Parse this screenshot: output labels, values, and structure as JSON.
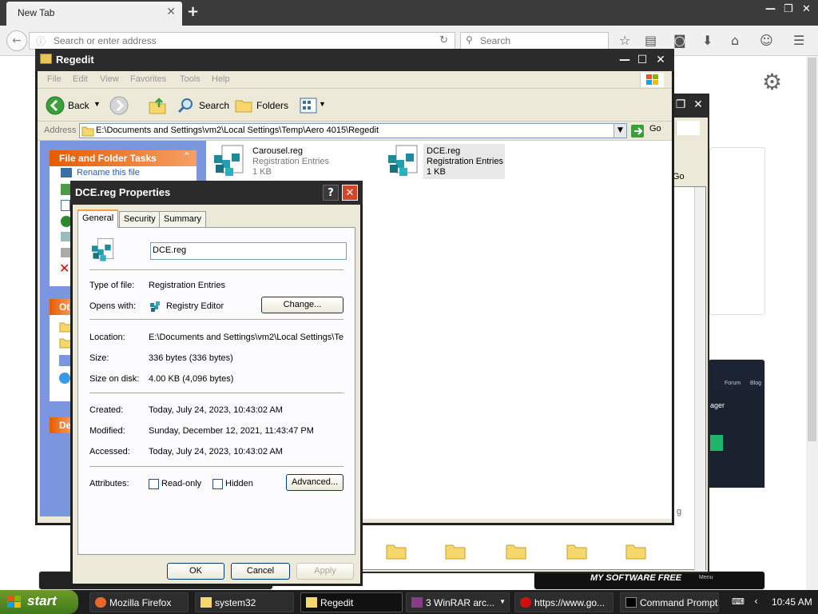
{
  "browser": {
    "tab_title": "New Tab",
    "url_placeholder": "Search or enter address",
    "search_placeholder": "Search"
  },
  "explorer": {
    "title": "Regedit",
    "menu": [
      "File",
      "Edit",
      "View",
      "Favorites",
      "Tools",
      "Help"
    ],
    "toolbar": {
      "back": "Back",
      "search": "Search",
      "folders": "Folders"
    },
    "address_label": "Address",
    "address_value": "E:\\Documents and Settings\\vm2\\Local Settings\\Temp\\Aero 4015\\Regedit",
    "go": "Go",
    "tasks_header": "File and Folder Tasks",
    "tasks_first_item": "Rename this file",
    "other_header": "Ot",
    "details_header": "De",
    "files": [
      {
        "name": "Carousel.reg",
        "type": "Registration Entries",
        "size": "1 KB"
      },
      {
        "name": "DCE.reg",
        "type": "Registration Entries",
        "size": "1 KB"
      }
    ]
  },
  "back_window": {
    "go": "Go",
    "forum": "Forum",
    "blog": "Blog",
    "text": "ager",
    "suffix": "g"
  },
  "dialog": {
    "title": "DCE.reg Properties",
    "tabs": [
      "General",
      "Security",
      "Summary"
    ],
    "file_name": "DCE.reg",
    "type_label": "Type of file:",
    "type_value": "Registration Entries",
    "opens_label": "Opens with:",
    "opens_value": "Registry Editor",
    "change_button": "Change...",
    "location_label": "Location:",
    "location_value": "E:\\Documents and Settings\\vm2\\Local Settings\\Te",
    "size_label": "Size:",
    "size_value": "336 bytes (336 bytes)",
    "size_disk_label": "Size on disk:",
    "size_disk_value": "4.00 KB (4,096 bytes)",
    "created_label": "Created:",
    "created_value": "Today, July 24, 2023, 10:43:02 AM",
    "modified_label": "Modified:",
    "modified_value": "Sunday, December 12, 2021, 11:43:47 PM",
    "accessed_label": "Accessed:",
    "accessed_value": "Today, July 24, 2023, 10:43:02 AM",
    "attributes_label": "Attributes:",
    "readonly_label": "Read-only",
    "hidden_label": "Hidden",
    "advanced_button": "Advanced...",
    "ok": "OK",
    "cancel": "Cancel",
    "apply": "Apply"
  },
  "taskbar": {
    "start": "start",
    "items": [
      "Mozilla Firefox",
      "system32",
      "Regedit",
      "3 WinRAR arc...",
      "https://www.go...",
      "Command Prompt"
    ],
    "time": "10:45 AM"
  },
  "banner": {
    "text": "MY SOFTWARE FREE",
    "menu": "Menu"
  }
}
